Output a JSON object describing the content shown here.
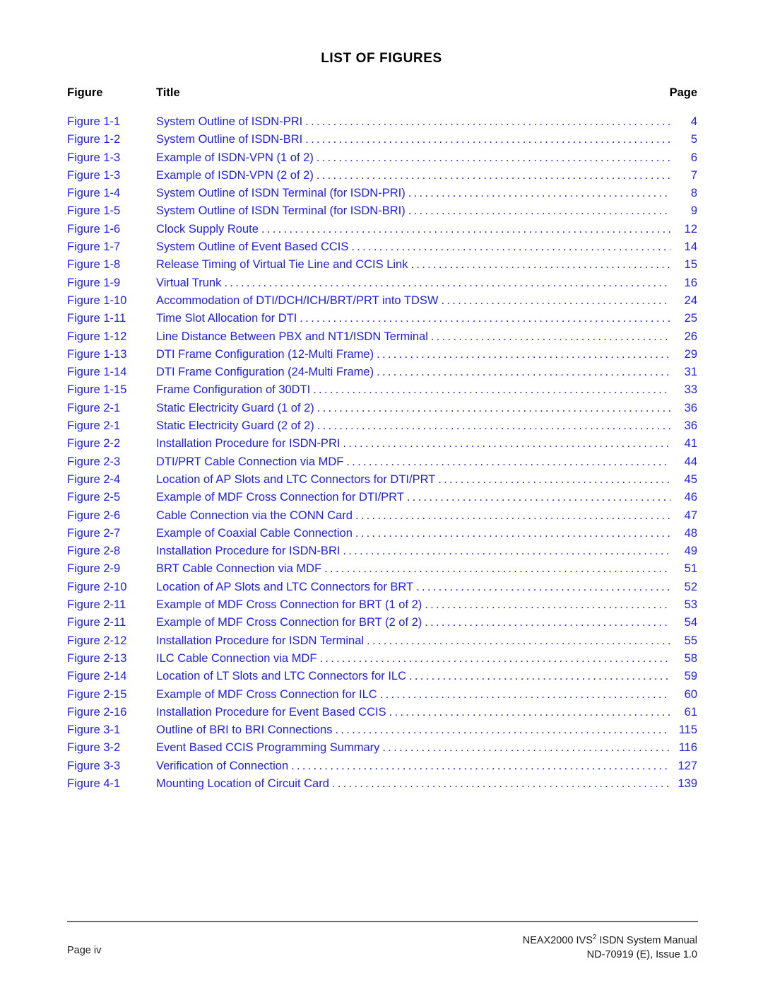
{
  "document": {
    "heading": "LIST OF FIGURES",
    "entry_color": "#2020EE",
    "heading_color": "#000000"
  },
  "columns": {
    "figure": "Figure",
    "title": "Title",
    "page": "Page"
  },
  "entries": [
    {
      "figure": "Figure 1-1",
      "title": "System Outline of ISDN-PRI",
      "page": "4"
    },
    {
      "figure": "Figure 1-2",
      "title": "System Outline of ISDN-BRI",
      "page": "5"
    },
    {
      "figure": "Figure 1-3",
      "title": "Example of ISDN-VPN (1 of 2)",
      "page": "6"
    },
    {
      "figure": "Figure 1-3",
      "title": "Example of ISDN-VPN (2 of 2)",
      "page": "7"
    },
    {
      "figure": "Figure 1-4",
      "title": "System Outline of ISDN Terminal (for ISDN-PRI)",
      "page": "8"
    },
    {
      "figure": "Figure 1-5",
      "title": "System Outline of ISDN Terminal (for ISDN-BRI)",
      "page": "9"
    },
    {
      "figure": "Figure 1-6",
      "title": "Clock Supply Route",
      "page": "12"
    },
    {
      "figure": "Figure 1-7",
      "title": "System Outline of Event Based CCIS",
      "page": "14"
    },
    {
      "figure": "Figure 1-8",
      "title": "Release Timing of Virtual Tie Line and CCIS Link",
      "page": "15"
    },
    {
      "figure": "Figure 1-9",
      "title": "Virtual Trunk",
      "page": "16"
    },
    {
      "figure": "Figure 1-10",
      "title": "Accommodation of DTI/DCH/ICH/BRT/PRT into TDSW",
      "page": "24"
    },
    {
      "figure": "Figure 1-11",
      "title": "Time Slot Allocation for DTI",
      "page": "25"
    },
    {
      "figure": "Figure 1-12",
      "title": "Line Distance Between PBX and NT1/ISDN Terminal",
      "page": "26"
    },
    {
      "figure": "Figure 1-13",
      "title": "DTI Frame Configuration (12-Multi Frame)",
      "page": "29"
    },
    {
      "figure": "Figure 1-14",
      "title": "DTI Frame Configuration (24-Multi Frame)",
      "page": "31"
    },
    {
      "figure": "Figure 1-15",
      "title": "Frame Configuration of 30DTI",
      "page": "33"
    },
    {
      "figure": "Figure 2-1",
      "title": "Static Electricity Guard (1 of 2)",
      "page": "36"
    },
    {
      "figure": "Figure 2-1",
      "title": "Static Electricity Guard (2 of 2)",
      "page": "36"
    },
    {
      "figure": "Figure 2-2",
      "title": "Installation Procedure for ISDN-PRI",
      "page": "41"
    },
    {
      "figure": "Figure 2-3",
      "title": "DTI/PRT Cable Connection via MDF",
      "page": "44"
    },
    {
      "figure": "Figure 2-4",
      "title": "Location of AP Slots and LTC Connectors for DTI/PRT",
      "page": "45"
    },
    {
      "figure": "Figure 2-5",
      "title": "Example of MDF Cross Connection for DTI/PRT",
      "page": "46"
    },
    {
      "figure": "Figure 2-6",
      "title": "Cable Connection via the CONN Card",
      "page": "47"
    },
    {
      "figure": "Figure 2-7",
      "title": "Example of Coaxial Cable Connection",
      "page": "48"
    },
    {
      "figure": "Figure 2-8",
      "title": "Installation Procedure for ISDN-BRI",
      "page": "49"
    },
    {
      "figure": "Figure 2-9",
      "title": "BRT Cable Connection via MDF",
      "page": "51"
    },
    {
      "figure": "Figure 2-10",
      "title": "Location of AP Slots and LTC Connectors for BRT",
      "page": "52"
    },
    {
      "figure": "Figure 2-11",
      "title": "Example of MDF Cross Connection for BRT (1 of 2)",
      "page": "53"
    },
    {
      "figure": "Figure 2-11",
      "title": "Example of MDF Cross Connection for BRT (2 of 2)",
      "page": "54"
    },
    {
      "figure": "Figure 2-12",
      "title": "Installation Procedure for ISDN Terminal",
      "page": "55"
    },
    {
      "figure": "Figure 2-13",
      "title": "ILC Cable Connection via MDF",
      "page": "58"
    },
    {
      "figure": "Figure 2-14",
      "title": "Location of LT Slots and LTC Connectors for ILC",
      "page": "59"
    },
    {
      "figure": "Figure 2-15",
      "title": "Example of MDF Cross Connection for ILC",
      "page": "60"
    },
    {
      "figure": "Figure 2-16",
      "title": "Installation Procedure for Event Based CCIS",
      "page": "61"
    },
    {
      "figure": "Figure 3-1",
      "title": "Outline of BRI to BRI Connections",
      "page": "115"
    },
    {
      "figure": "Figure 3-2",
      "title": "Event Based CCIS Programming Summary",
      "page": "116"
    },
    {
      "figure": "Figure 3-3",
      "title": "Verification of Connection",
      "page": "127"
    },
    {
      "figure": "Figure 4-1",
      "title": "Mounting Location of Circuit Card",
      "page": "139"
    }
  ],
  "footer": {
    "page_label": "Page iv",
    "manual_prefix": "NEAX2000 IVS",
    "manual_superscript": "2",
    "manual_suffix": " ISDN System Manual",
    "document_number": "ND-70919 (E), Issue 1.0"
  }
}
